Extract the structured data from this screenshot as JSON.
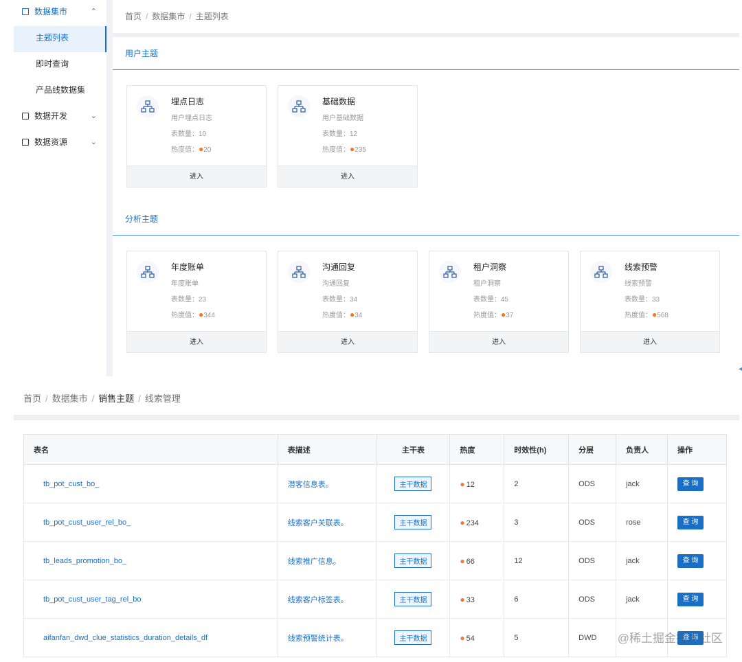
{
  "sidebar": {
    "items": [
      {
        "label": "数据集市",
        "icon": "grid-icon",
        "chevron": "⌃"
      },
      {
        "label": "数据开发",
        "icon": "terminal-icon",
        "chevron": "⌄"
      },
      {
        "label": "数据资源",
        "icon": "apps-icon",
        "chevron": "⌄"
      }
    ],
    "sub_items": [
      "主题列表",
      "即时查询",
      "产品线数据集"
    ]
  },
  "top_breadcrumb": [
    "首页",
    "数据集市",
    "主题列表"
  ],
  "sections": [
    {
      "title": "用户主题",
      "cards": [
        {
          "name": "埋点日志",
          "desc": "用户埋点日志",
          "count_label": "表数量：",
          "count": "10",
          "hot_label": "热度值：",
          "hot": "20",
          "enter": "进入"
        },
        {
          "name": "基础数据",
          "desc": "用户基础数据",
          "count_label": "表数量：",
          "count": "12",
          "hot_label": "热度值：",
          "hot": "235",
          "enter": "进入"
        }
      ]
    },
    {
      "title": "分析主题",
      "cards": [
        {
          "name": "年度账单",
          "desc": "年度账单",
          "count_label": "表数量：",
          "count": "23",
          "hot_label": "热度值：",
          "hot": "344",
          "enter": "进入"
        },
        {
          "name": "沟通回复",
          "desc": "沟通回复",
          "count_label": "表数量：",
          "count": "34",
          "hot_label": "热度值：",
          "hot": "34",
          "enter": "进入"
        },
        {
          "name": "租户洞察",
          "desc": "租户洞察",
          "count_label": "表数量：",
          "count": "45",
          "hot_label": "热度值：",
          "hot": "37",
          "enter": "进入"
        },
        {
          "name": "线索预警",
          "desc": "线索预警",
          "count_label": "表数量：",
          "count": "33",
          "hot_label": "热度值：",
          "hot": "568",
          "enter": "进入"
        }
      ]
    }
  ],
  "bottom_breadcrumb": [
    "首页",
    "数据集市",
    "销售主题",
    "线索管理"
  ],
  "table": {
    "headers": [
      "表名",
      "表描述",
      "主干表",
      "热度",
      "时效性(h)",
      "分层",
      "负责人",
      "操作"
    ],
    "rows": [
      {
        "name": "tb_pot_cust_bo_",
        "desc": "潜客信息表。",
        "tag": "主干数据",
        "hot": "12",
        "timeliness": "2",
        "layer": "ODS",
        "owner": "jack",
        "action": "查 询"
      },
      {
        "name": "tb_pot_cust_user_rel_bo_",
        "desc": "线索客户关联表。",
        "tag": "主干数据",
        "hot": "234",
        "timeliness": "3",
        "layer": "ODS",
        "owner": "rose",
        "action": "查 询"
      },
      {
        "name": "tb_leads_promotion_bo_",
        "desc": "线索推广信息。",
        "tag": "主干数据",
        "hot": "66",
        "timeliness": "12",
        "layer": "ODS",
        "owner": "jack",
        "action": "查 询"
      },
      {
        "name": "tb_pot_cust_user_tag_rel_bo",
        "desc": "线索客户标签表。",
        "tag": "主干数据",
        "hot": "33",
        "timeliness": "6",
        "layer": "ODS",
        "owner": "jack",
        "action": "查 询"
      },
      {
        "name": "aifanfan_dwd_clue_statistics_duration_details_df",
        "desc": "线索预警统计表。",
        "tag": "主干数据",
        "hot": "54",
        "timeliness": "5",
        "layer": "DWD",
        "owner": "",
        "action": "查 询"
      }
    ]
  },
  "watermark": "@稀土掘金技术社区",
  "colors": {
    "accent": "#1a6fc4",
    "flame": "#f07a2c"
  }
}
